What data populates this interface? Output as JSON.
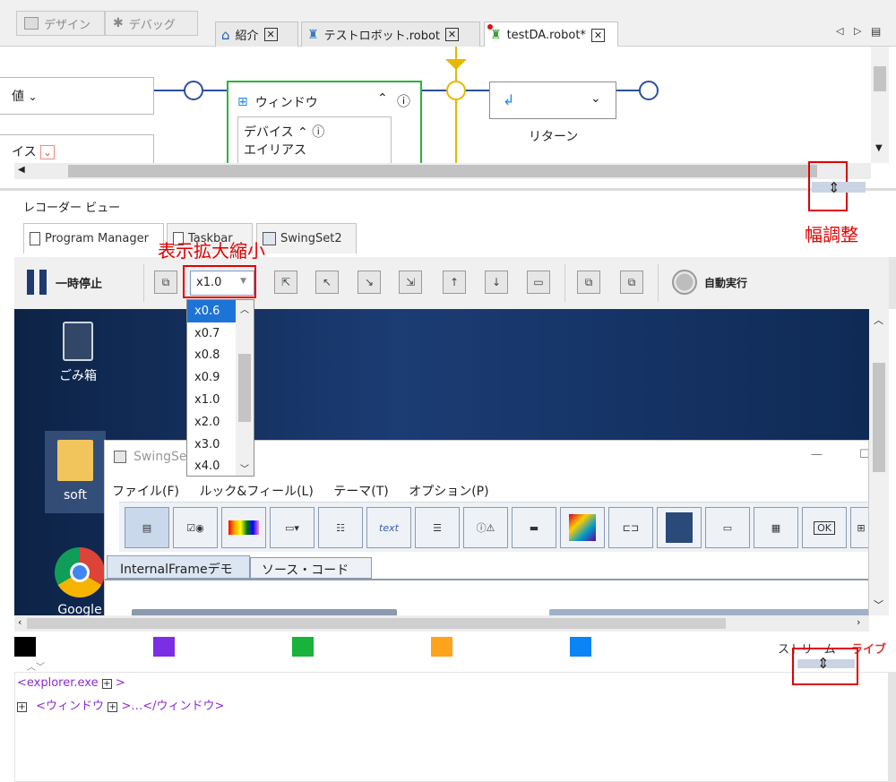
{
  "mode_buttons": {
    "design": "デザイン",
    "debug": "デバッグ"
  },
  "tabs": [
    {
      "label": "紹介"
    },
    {
      "label": "テストロボット.robot"
    },
    {
      "label": "testDA.robot*"
    }
  ],
  "flow": {
    "left_partial_1": "値",
    "left_partial_2": "イス",
    "window_node": {
      "title": "ウィンドウ",
      "device": "デバイス",
      "alias": "エイリアス"
    },
    "return_label": "リターン"
  },
  "recorder": {
    "title": "レコーダー ビュー",
    "tabs": [
      "Program Manager",
      "Taskbar",
      "SwingSet2"
    ],
    "pause_label": "一時停止",
    "zoom_value": "x1.0",
    "auto_run_label": "自動実行",
    "zoom_options": [
      "x0.6",
      "x0.7",
      "x0.8",
      "x0.9",
      "x1.0",
      "x2.0",
      "x3.0",
      "x4.0"
    ]
  },
  "desktop": {
    "recycle_label": "ごみ箱",
    "soft_label": "soft",
    "chrome_label": "Google Chr",
    "swing_title": "SwingSet",
    "swing_menu": [
      "ファイル(F)",
      "ルック&フィール(L)",
      "テーマ(T)",
      "オプション(P)"
    ],
    "swing_tabs": [
      "InternalFrameデモ",
      "ソース・コード"
    ],
    "text_icon": "text",
    "ok_icon": "OK"
  },
  "stream": {
    "label_a": "ストリーム",
    "label_b": "ライブ"
  },
  "swatch_colors": [
    "#000000",
    "#7b2ee6",
    "#19b23a",
    "#ffa21c",
    "#0b84f5"
  ],
  "tree": {
    "line1": "<explorer.exe",
    "line1_end": ">",
    "line2": "<ウィンドウ",
    "line2_end": ">…</ウィンドウ>"
  },
  "annotations": {
    "zoom": "表示拡大縮小",
    "width": "幅調整"
  }
}
